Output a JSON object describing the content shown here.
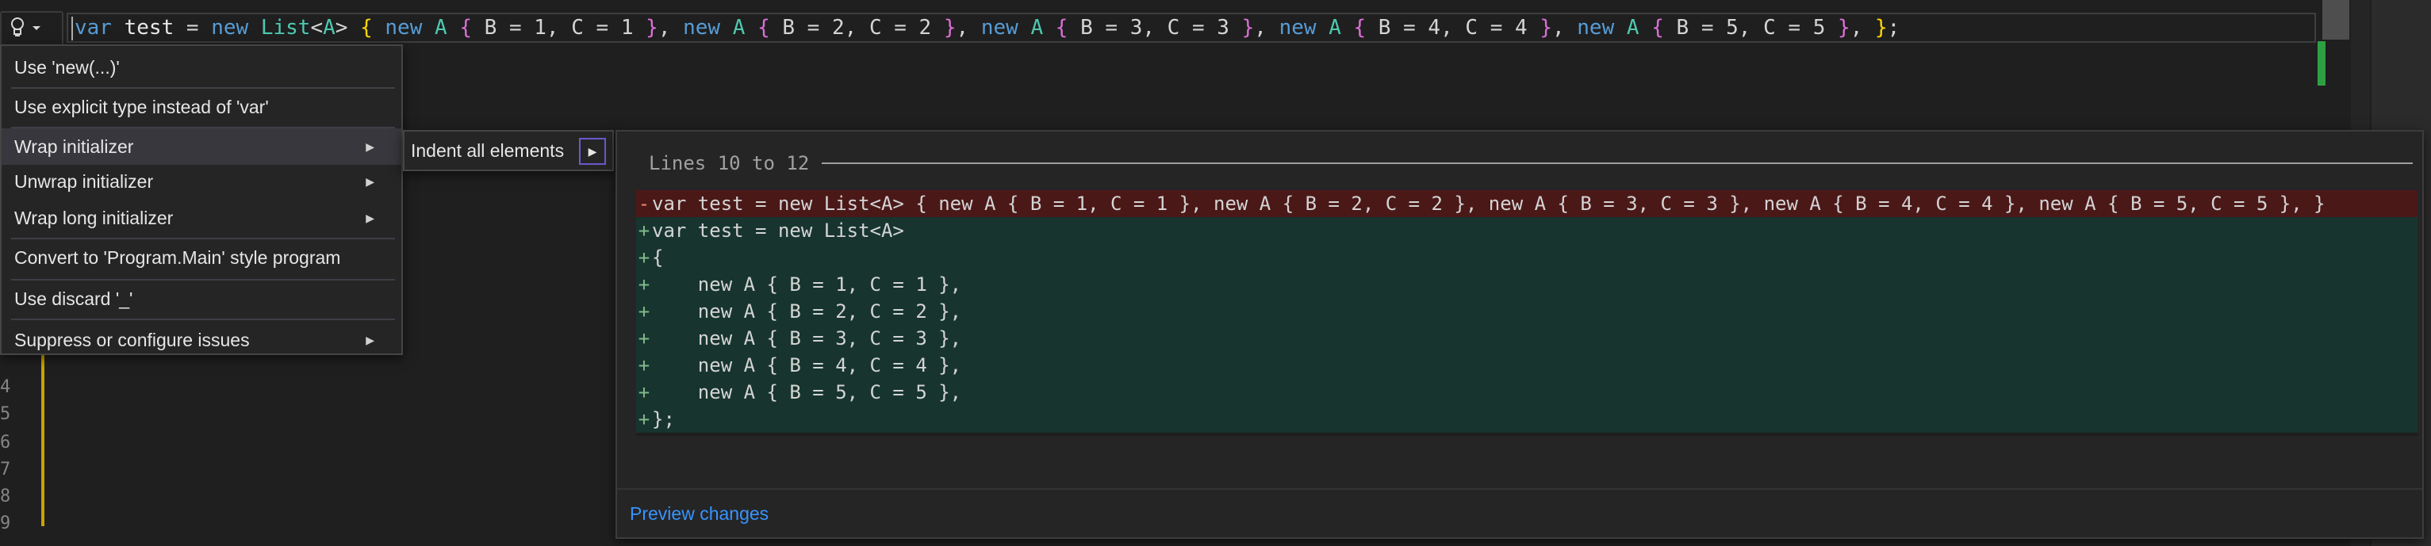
{
  "editor": {
    "line_numbers": [
      "4",
      "5",
      "6",
      "7",
      "8",
      "9"
    ],
    "code_tokens": [
      {
        "t": "var",
        "c": "kw"
      },
      {
        "t": " ",
        "c": ""
      },
      {
        "t": "test",
        "c": "id"
      },
      {
        "t": " = ",
        "c": ""
      },
      {
        "t": "new",
        "c": "kw"
      },
      {
        "t": " ",
        "c": ""
      },
      {
        "t": "List",
        "c": "ty"
      },
      {
        "t": "<",
        "c": ""
      },
      {
        "t": "A",
        "c": "ty"
      },
      {
        "t": "> ",
        "c": ""
      },
      {
        "t": "{",
        "c": "br"
      },
      {
        "t": " ",
        "c": ""
      },
      {
        "t": "new",
        "c": "kw"
      },
      {
        "t": " ",
        "c": ""
      },
      {
        "t": "A",
        "c": "ty"
      },
      {
        "t": " ",
        "c": ""
      },
      {
        "t": "{",
        "c": "br2"
      },
      {
        "t": " B = 1, C = 1 ",
        "c": ""
      },
      {
        "t": "}",
        "c": "br2"
      },
      {
        "t": ", ",
        "c": ""
      },
      {
        "t": "new",
        "c": "kw"
      },
      {
        "t": " ",
        "c": ""
      },
      {
        "t": "A",
        "c": "ty"
      },
      {
        "t": " ",
        "c": ""
      },
      {
        "t": "{",
        "c": "br2"
      },
      {
        "t": " B = 2, C = 2 ",
        "c": ""
      },
      {
        "t": "}",
        "c": "br2"
      },
      {
        "t": ", ",
        "c": ""
      },
      {
        "t": "new",
        "c": "kw"
      },
      {
        "t": " ",
        "c": ""
      },
      {
        "t": "A",
        "c": "ty"
      },
      {
        "t": " ",
        "c": ""
      },
      {
        "t": "{",
        "c": "br2"
      },
      {
        "t": " B = 3, C = 3 ",
        "c": ""
      },
      {
        "t": "}",
        "c": "br2"
      },
      {
        "t": ", ",
        "c": ""
      },
      {
        "t": "new",
        "c": "kw"
      },
      {
        "t": " ",
        "c": ""
      },
      {
        "t": "A",
        "c": "ty"
      },
      {
        "t": " ",
        "c": ""
      },
      {
        "t": "{",
        "c": "br2"
      },
      {
        "t": " B = 4, C = 4 ",
        "c": ""
      },
      {
        "t": "}",
        "c": "br2"
      },
      {
        "t": ", ",
        "c": ""
      },
      {
        "t": "new",
        "c": "kw"
      },
      {
        "t": " ",
        "c": ""
      },
      {
        "t": "A",
        "c": "ty"
      },
      {
        "t": " ",
        "c": ""
      },
      {
        "t": "{",
        "c": "br2"
      },
      {
        "t": " B = 5, C = 5 ",
        "c": ""
      },
      {
        "t": "}",
        "c": "br2"
      },
      {
        "t": ", ",
        "c": ""
      },
      {
        "t": "}",
        "c": "br"
      },
      {
        "t": ";",
        "c": ""
      }
    ]
  },
  "menu": {
    "items": [
      {
        "label": "Use 'new(...)'",
        "has_submenu": false
      },
      {
        "label": "Use explicit type instead of 'var'",
        "has_submenu": false
      },
      {
        "label": "Wrap initializer",
        "has_submenu": true,
        "active": true
      },
      {
        "label": "Unwrap initializer",
        "has_submenu": true
      },
      {
        "label": "Wrap long initializer",
        "has_submenu": true
      },
      {
        "label": "Convert to 'Program.Main' style program",
        "has_submenu": false
      },
      {
        "label": "Use discard '_'",
        "has_submenu": false
      },
      {
        "label": "Suppress or configure issues",
        "has_submenu": true
      }
    ],
    "arrow_glyph": "▶"
  },
  "submenu": {
    "label": "Indent all elements",
    "arrow_glyph": "▶"
  },
  "preview": {
    "header_title": "Lines 10 to 12",
    "footer_link": "Preview changes",
    "removed_line": "var test = new List<A> { new A { B = 1, C = 1 }, new A { B = 2, C = 2 }, new A { B = 3, C = 3 }, new A { B = 4, C = 4 }, new A { B = 5, C = 5 }, }",
    "added_lines": [
      "var test = new List<A>",
      "{",
      "    new A { B = 1, C = 1 },",
      "    new A { B = 2, C = 2 },",
      "    new A { B = 3, C = 3 },",
      "    new A { B = 4, C = 4 },",
      "    new A { B = 5, C = 5 },",
      "};"
    ],
    "del_sign": "-",
    "add_sign": "+"
  },
  "colors": {
    "keyword": "#569cd6",
    "type": "#4ec9b0",
    "deleted_bg": "#4b1818",
    "added_bg": "#17352e",
    "link": "#3794ff"
  },
  "icons": {
    "lightbulb": "lightbulb-icon",
    "dropdown": "chevron-down-icon",
    "submenu_arrow": "chevron-right-icon"
  }
}
